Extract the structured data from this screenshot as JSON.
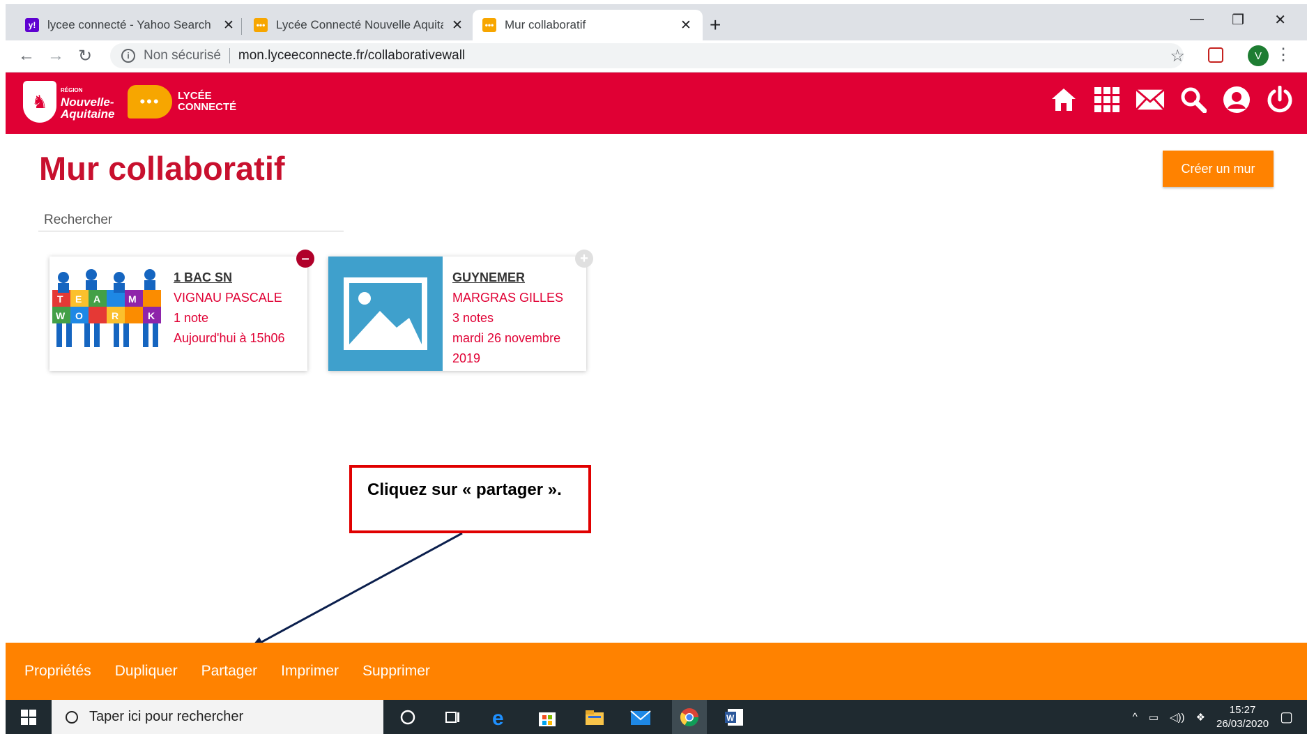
{
  "browser": {
    "tabs": [
      {
        "title": "lycee connecté - Yahoo Search - ",
        "active": false
      },
      {
        "title": "Lycée Connecté Nouvelle Aquitai",
        "active": false
      },
      {
        "title": "Mur collaboratif",
        "active": true
      }
    ],
    "close_glyph": "✕",
    "new_tab": "+",
    "security_label": "Non sécurisé",
    "url": "mon.lyceeconnecte.fr/collaborativewall",
    "profile_initial": "V"
  },
  "site": {
    "region_small": "RÉGION",
    "region_name_line1": "Nouvelle-",
    "region_name_line2": "Aquitaine",
    "brand_line1": "LYCÉE",
    "brand_line2": "CONNECTÉ",
    "header_icons": [
      "home-icon",
      "apps-grid-icon",
      "mail-icon",
      "search-icon",
      "user-icon",
      "power-icon"
    ],
    "brand_color": "#e00034",
    "accent_color": "#ff8200"
  },
  "main": {
    "title": "Mur collaboratif",
    "create_button": "Créer un mur",
    "search_placeholder": "Rechercher"
  },
  "walls": [
    {
      "name": "1 BAC SN",
      "author": "VIGNAU PASCALE",
      "notes": "1 note",
      "date": "Aujourd'hui à 15h06",
      "badge": "–",
      "selected": true
    },
    {
      "name": "GUYNEMER",
      "author": "MARGRAS GILLES",
      "notes": "3 notes",
      "date": "mardi 26 novembre 2019",
      "badge": "+",
      "selected": false
    }
  ],
  "annotation": {
    "text": "Cliquez sur « partager »."
  },
  "actions": [
    "Propriétés",
    "Dupliquer",
    "Partager",
    "Imprimer",
    "Supprimer"
  ],
  "taskbar": {
    "search_placeholder": "Taper ici pour rechercher",
    "time": "15:27",
    "date": "26/03/2020"
  }
}
